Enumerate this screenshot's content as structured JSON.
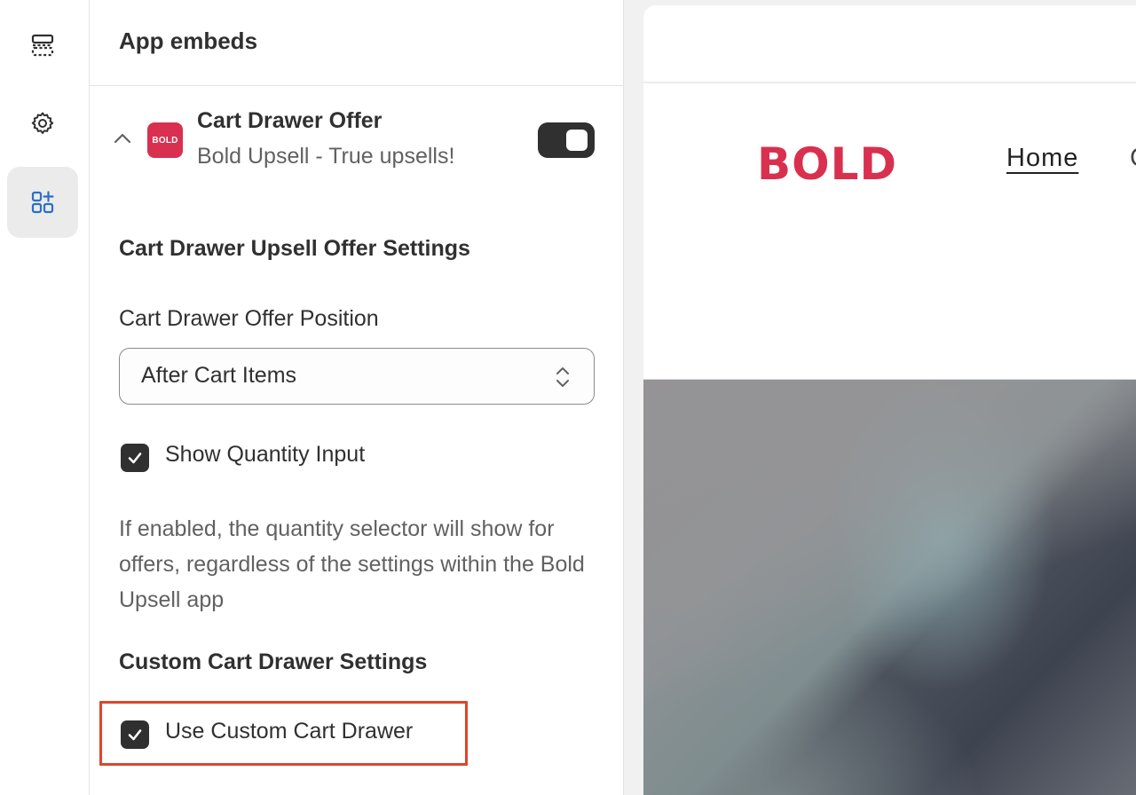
{
  "panel": {
    "title": "App embeds"
  },
  "embed": {
    "logo_text": "BOLD",
    "name": "Cart Drawer Offer",
    "subtitle": "Bold Upsell - True upsells!",
    "enabled": true
  },
  "upsell_settings": {
    "section_title": "Cart Drawer Upsell Offer Settings",
    "position_label": "Cart Drawer Offer Position",
    "position_value": "After Cart Items",
    "show_quantity_label": "Show Quantity Input",
    "show_quantity_checked": true,
    "help_text": "If enabled, the quantity selector will show for offers, regardless of the settings within the Bold Upsell app"
  },
  "custom_drawer": {
    "section_title": "Custom Cart Drawer Settings",
    "use_custom_label": "Use Custom Cart Drawer",
    "use_custom_checked": true
  },
  "preview": {
    "brand": "BOLD",
    "nav_home": "Home",
    "nav_next": "C"
  },
  "colors": {
    "brand": "#d9304f",
    "highlight": "#e0442b",
    "active_icon": "#2c6ecb",
    "dark": "#303030"
  },
  "icons": {
    "rail_sections": "sections-icon",
    "rail_settings": "gear-icon",
    "rail_apps": "app-embeds-icon"
  }
}
